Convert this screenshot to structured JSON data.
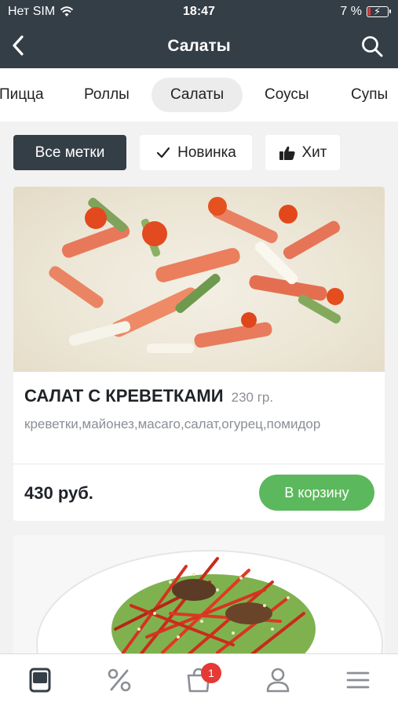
{
  "status_bar": {
    "carrier": "Нет SIM",
    "time": "18:47",
    "battery": "7 %"
  },
  "nav": {
    "title": "Салаты",
    "icons": {
      "back": "back-chevron-icon",
      "search": "search-icon"
    }
  },
  "categories": [
    {
      "label": "Пицца",
      "active": false
    },
    {
      "label": "Роллы",
      "active": false
    },
    {
      "label": "Салаты",
      "active": true
    },
    {
      "label": "Соусы",
      "active": false
    },
    {
      "label": "Супы",
      "active": false
    }
  ],
  "filters": [
    {
      "label": "Все метки",
      "icon": "",
      "selected": true
    },
    {
      "label": "Новинка",
      "icon": "checkmark-icon",
      "selected": false
    },
    {
      "label": "Хит",
      "icon": "thumbs-up-icon",
      "selected": false
    }
  ],
  "products": [
    {
      "name": "САЛАТ С КРЕВЕТКАМИ",
      "weight": "230 гр.",
      "ingredients": "креветки,майонез,масаго,салат,огурец,помидор",
      "price": "430 руб.",
      "button": "В корзину"
    },
    {
      "name": "",
      "weight": "",
      "ingredients": "",
      "price": "",
      "button": ""
    }
  ],
  "tab_bar": {
    "items": [
      "menu-icon",
      "discount-icon",
      "cart-icon",
      "profile-icon",
      "more-icon"
    ],
    "cart_badge": "1"
  },
  "colors": {
    "header": "#343e47",
    "accent_green": "#5cb85c",
    "badge_red": "#e53935"
  }
}
